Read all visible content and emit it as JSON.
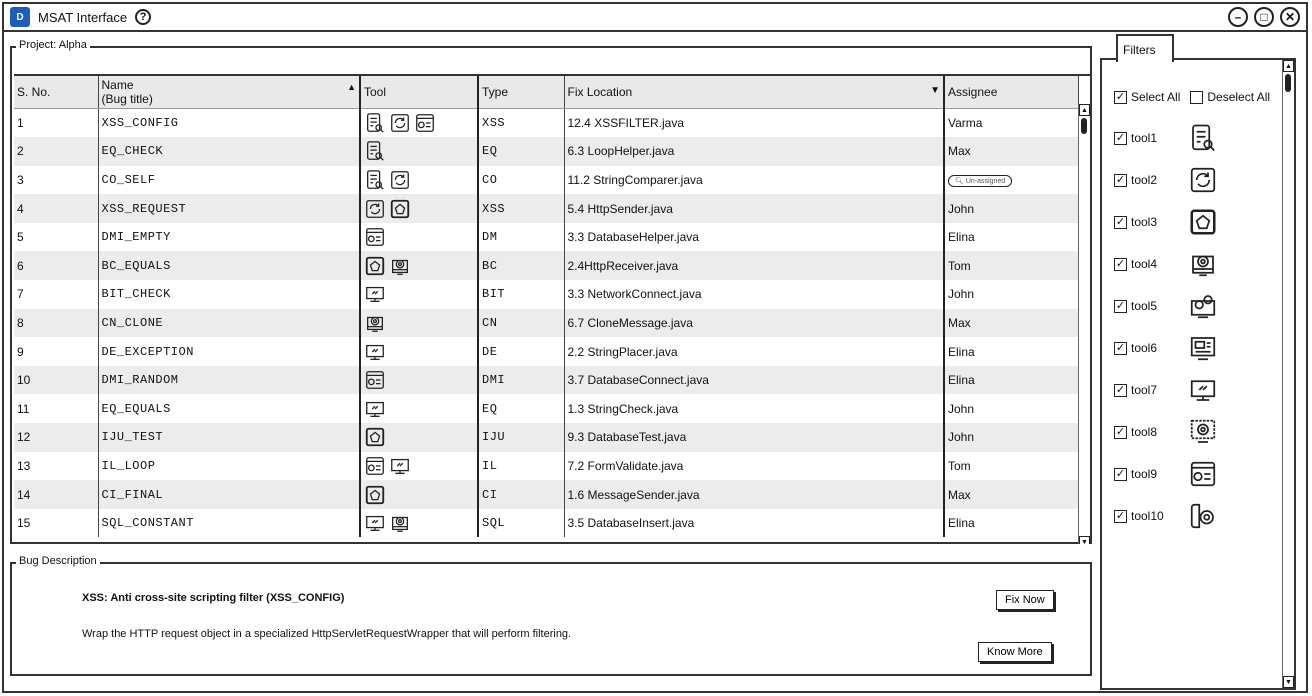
{
  "window": {
    "title": "MSAT Interface",
    "help_icon": "?",
    "app_icon_label": "D",
    "minimize": "–",
    "maximize": "□",
    "close": "✕"
  },
  "project": {
    "legend": "Project: Alpha",
    "columns": {
      "sno": "S. No.",
      "name": "Name\n(Bug title)",
      "name_line1": "Name",
      "name_line2": "(Bug title)",
      "tool": "Tool",
      "type": "Type",
      "fix_location": "Fix Location",
      "assignee": "Assignee"
    },
    "rows": [
      {
        "sno": "1",
        "name": "XSS_CONFIG",
        "tools": [
          "tool1",
          "tool2",
          "tool9"
        ],
        "type": "XSS",
        "fix": "12.4 XSSFILTER.java",
        "assignee": "Varma"
      },
      {
        "sno": "2",
        "name": "EQ_CHECK",
        "tools": [
          "tool1"
        ],
        "type": "EQ",
        "fix": "6.3 LoopHelper.java",
        "assignee": "Max"
      },
      {
        "sno": "3",
        "name": "CO_SELF",
        "tools": [
          "tool1",
          "tool2"
        ],
        "type": "CO",
        "fix": "11.2 StringComparer.java",
        "assignee": "Un-assigned"
      },
      {
        "sno": "4",
        "name": "XSS_REQUEST",
        "tools": [
          "tool2",
          "tool3"
        ],
        "type": "XSS",
        "fix": "5.4 HttpSender.java",
        "assignee": "John"
      },
      {
        "sno": "5",
        "name": "DMI_EMPTY",
        "tools": [
          "tool9"
        ],
        "type": "DM",
        "fix": "3.3 DatabaseHelper.java",
        "assignee": "Elina"
      },
      {
        "sno": "6",
        "name": "BC_EQUALS",
        "tools": [
          "tool3",
          "tool4"
        ],
        "type": "BC",
        "fix": "2.4HttpReceiver.java",
        "assignee": "Tom"
      },
      {
        "sno": "7",
        "name": "BIT_CHECK",
        "tools": [
          "tool7"
        ],
        "type": "BIT",
        "fix": "3.3 NetworkConnect.java",
        "assignee": "John"
      },
      {
        "sno": "8",
        "name": "CN_CLONE",
        "tools": [
          "tool4"
        ],
        "type": "CN",
        "fix": "6.7 CloneMessage.java",
        "assignee": "Max"
      },
      {
        "sno": "9",
        "name": "DE_EXCEPTION",
        "tools": [
          "tool7"
        ],
        "type": "DE",
        "fix": "2.2 StringPlacer.java",
        "assignee": "Elina"
      },
      {
        "sno": "10",
        "name": "DMI_RANDOM",
        "tools": [
          "tool9"
        ],
        "type": "DMI",
        "fix": "3.7 DatabaseConnect.java",
        "assignee": "Elina"
      },
      {
        "sno": "11",
        "name": "EQ_EQUALS",
        "tools": [
          "tool7"
        ],
        "type": "EQ",
        "fix": "1.3 StringCheck.java",
        "assignee": "John"
      },
      {
        "sno": "12",
        "name": "IJU_TEST",
        "tools": [
          "tool3"
        ],
        "type": "IJU",
        "fix": "9.3 DatabaseTest.java",
        "assignee": "John"
      },
      {
        "sno": "13",
        "name": "IL_LOOP",
        "tools": [
          "tool9",
          "tool7"
        ],
        "type": "IL",
        "fix": "7.2 FormValidate.java",
        "assignee": "Tom"
      },
      {
        "sno": "14",
        "name": "CI_FINAL",
        "tools": [
          "tool3"
        ],
        "type": "CI",
        "fix": "1.6 MessageSender.java",
        "assignee": "Max"
      },
      {
        "sno": "15",
        "name": "SQL_CONSTANT",
        "tools": [
          "tool7",
          "tool4"
        ],
        "type": "SQL",
        "fix": "3.5 DatabaseInsert.java",
        "assignee": "Elina"
      }
    ]
  },
  "bug_description": {
    "legend": "Bug Description",
    "title": "XSS: Anti cross-site scripting filter (XSS_CONFIG)",
    "text": "Wrap the HTTP request object in a specialized HttpServletRequestWrapper that will perform filtering.",
    "fix_now": "Fix Now",
    "know_more": "Know More"
  },
  "filters": {
    "tab_label": "Filters",
    "select_all": "Select All",
    "deselect_all": "Deselect All",
    "select_all_checked": true,
    "deselect_all_checked": false,
    "tools": [
      {
        "label": "tool1",
        "checked": true,
        "icon": "list-search-icon"
      },
      {
        "label": "tool2",
        "checked": true,
        "icon": "refresh-icon"
      },
      {
        "label": "tool3",
        "checked": true,
        "icon": "pentagon-icon"
      },
      {
        "label": "tool4",
        "checked": true,
        "icon": "gear-computer-icon"
      },
      {
        "label": "tool5",
        "checked": true,
        "icon": "gears-monitor-icon"
      },
      {
        "label": "tool6",
        "checked": true,
        "icon": "document-monitor-icon"
      },
      {
        "label": "tool7",
        "checked": true,
        "icon": "monitor-icon"
      },
      {
        "label": "tool8",
        "checked": true,
        "icon": "gear-monitor-icon"
      },
      {
        "label": "tool9",
        "checked": true,
        "icon": "window-settings-icon"
      },
      {
        "label": "tool10",
        "checked": true,
        "icon": "gear-book-icon"
      }
    ]
  }
}
